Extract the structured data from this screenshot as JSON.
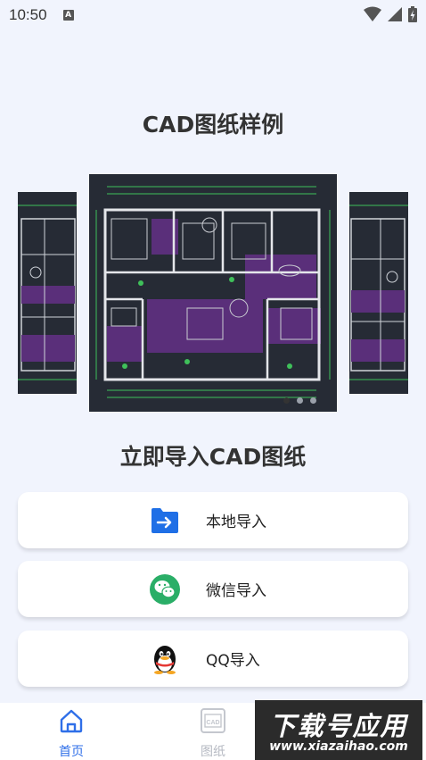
{
  "status_bar": {
    "time": "10:50",
    "notification_letter": "A"
  },
  "section": {
    "samples_title": "CAD图纸样例",
    "import_title": "立即导入CAD图纸"
  },
  "carousel": {
    "slide_count": 3,
    "active_index": 0
  },
  "import_buttons": [
    {
      "label": "本地导入",
      "icon": "folder-arrow-icon"
    },
    {
      "label": "微信导入",
      "icon": "wechat-icon"
    },
    {
      "label": "QQ导入",
      "icon": "qq-penguin-icon"
    }
  ],
  "bottom_nav": {
    "items": [
      {
        "label": "首页",
        "icon": "home-icon",
        "active": true
      },
      {
        "label": "图纸",
        "icon": "cad-drawing-icon",
        "active": false
      }
    ]
  },
  "watermark": {
    "text": "下载号应用",
    "url": "www.xiazaihao.com"
  },
  "colors": {
    "background": "#f1f4fd",
    "accent": "#2f6fe8",
    "wechat_green": "#2aae67",
    "cad_background": "#262b35"
  }
}
